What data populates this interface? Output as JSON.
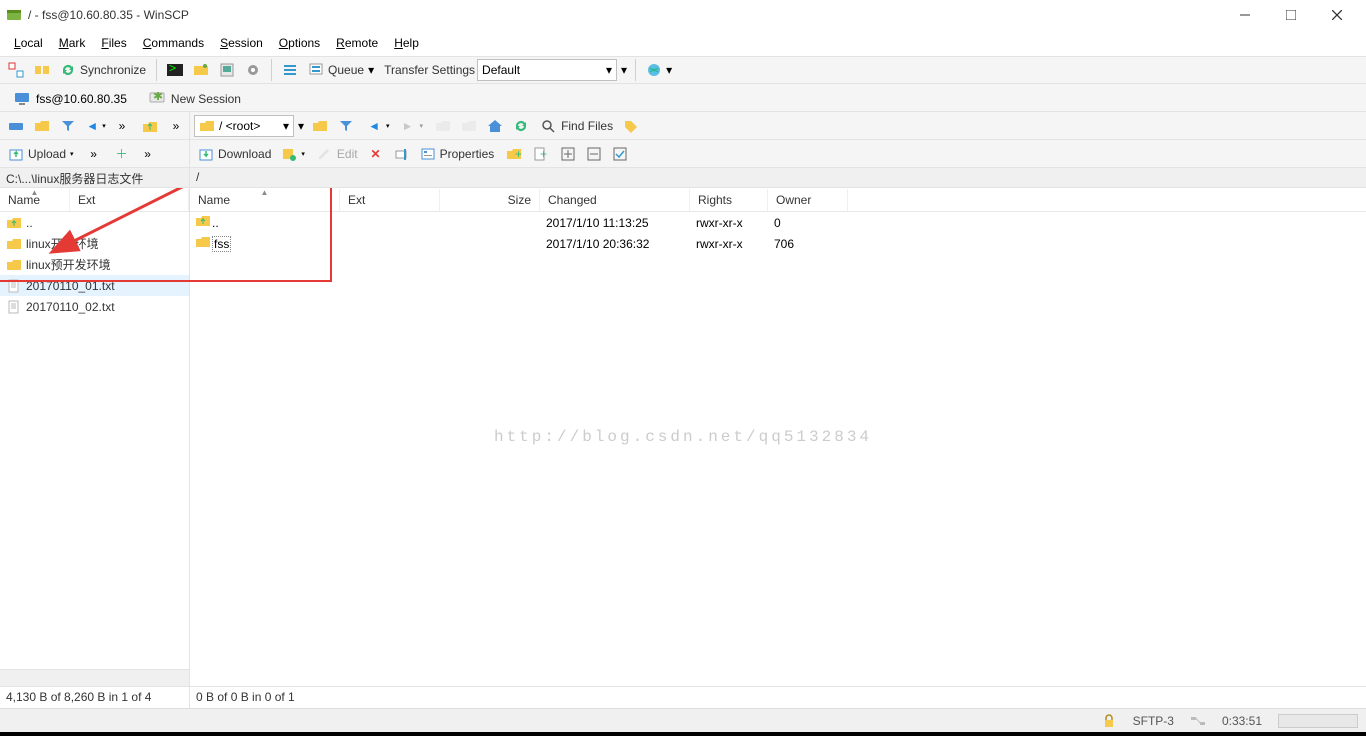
{
  "title": "/ - fss@10.60.80.35 - WinSCP",
  "menu": {
    "local": "Local",
    "mark": "Mark",
    "files": "Files",
    "commands": "Commands",
    "session": "Session",
    "options": "Options",
    "remote": "Remote",
    "help": "Help"
  },
  "toolbar1": {
    "synchronize": "Synchronize",
    "queue": "Queue",
    "transfer_label": "Transfer Settings",
    "transfer_value": "Default"
  },
  "session_tabs": {
    "active": "fss@10.60.80.35",
    "new": "New Session"
  },
  "remote_nav": {
    "root_selector": "/ <root>",
    "find": "Find Files"
  },
  "local_ops": {
    "upload": "Upload"
  },
  "remote_ops": {
    "download": "Download",
    "edit": "Edit",
    "properties": "Properties"
  },
  "paths": {
    "local": "C:\\...\\linux服务器日志文件",
    "remote": "/"
  },
  "local_cols": {
    "name": "Name",
    "ext": "Ext"
  },
  "remote_cols": {
    "name": "Name",
    "ext": "Ext",
    "size": "Size",
    "changed": "Changed",
    "rights": "Rights",
    "owner": "Owner"
  },
  "local_files": {
    "parent": "..",
    "f1": "linux开发环境",
    "f2": "linux预开发环境",
    "f3": "20170110_01.txt",
    "f4": "20170110_02.txt"
  },
  "remote_files": {
    "parent": {
      "name": "..",
      "changed": "2017/1/10 11:13:25",
      "rights": "rwxr-xr-x",
      "owner": "0"
    },
    "r1": {
      "name": "fss",
      "changed": "2017/1/10 20:36:32",
      "rights": "rwxr-xr-x",
      "owner": "706"
    }
  },
  "status": {
    "local": "4,130 B of 8,260 B in 1 of 4",
    "remote": "0 B of 0 B in 0 of 1"
  },
  "bottom": {
    "protocol": "SFTP-3",
    "time": "0:33:51"
  },
  "watermark": "http://blog.csdn.net/qq5132834"
}
